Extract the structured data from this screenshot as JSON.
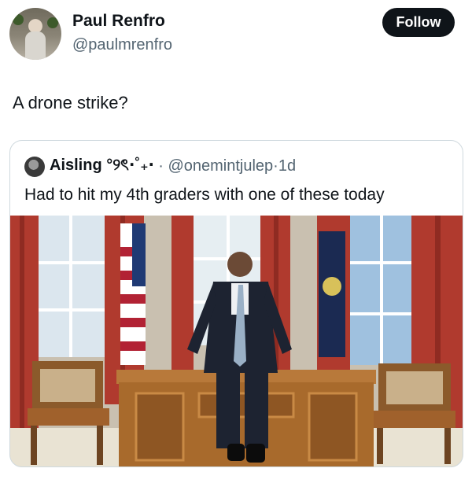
{
  "author": {
    "name": "Paul Renfro",
    "handle": "@paulmrenfro",
    "follow_label": "Follow"
  },
  "tweet": {
    "text": "A drone strike?"
  },
  "quoted_tweet": {
    "name": "Aisling °୨ৎ⋅˚₊‧",
    "handle": "@onemintjulep",
    "separator": "·",
    "time": "1d",
    "text": "Had to hit my 4th graders with one of these today",
    "image_icon": "photo-image-icon"
  },
  "colors": {
    "text_primary": "#0f1419",
    "text_secondary": "#536471",
    "border": "#cfd9de",
    "button_bg": "#0f1419",
    "curtain": "#b03a2e",
    "carpet": "#e9e3d3",
    "wood": "#a86a2c"
  }
}
